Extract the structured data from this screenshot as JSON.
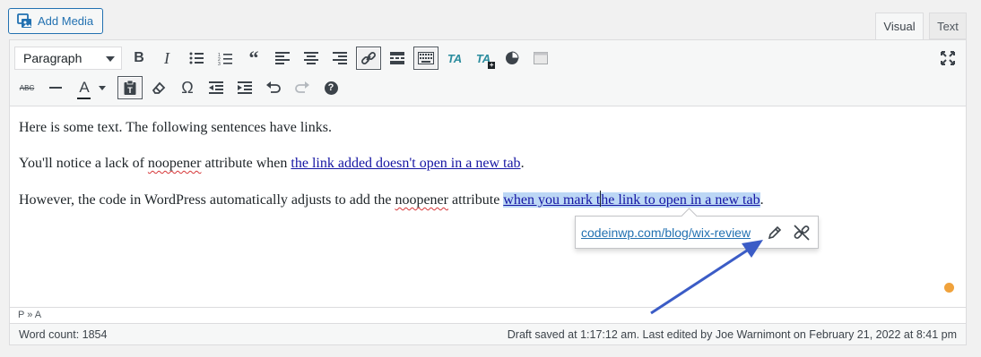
{
  "add_media": {
    "label": "Add Media"
  },
  "tabs": {
    "visual": "Visual",
    "text": "Text"
  },
  "toolbar": {
    "format_select": "Paragraph",
    "row1_icons": [
      "bold-icon",
      "italic-icon",
      "bulleted-list-icon",
      "numbered-list-icon",
      "blockquote-icon",
      "align-left-icon",
      "align-center-icon",
      "align-right-icon",
      "insert-link-icon",
      "read-more-icon",
      "toolbar-toggle-icon",
      "ta-icon",
      "ta-plus-icon",
      "pie-chart-icon",
      "shortcode-icon"
    ],
    "row2_icons": [
      "strikethrough-icon",
      "horizontal-line-icon",
      "text-color-icon",
      "paste-text-icon",
      "clear-formatting-icon",
      "special-character-icon",
      "outdent-icon",
      "indent-icon",
      "undo-icon",
      "redo-icon",
      "help-icon"
    ],
    "bold": "B",
    "italic": "I",
    "omega": "Ω",
    "strike": "ABC",
    "text_color": "A",
    "ta": "TA",
    "help": "?"
  },
  "content": {
    "p1": "Here is some text. The following sentences have links.",
    "p2_before": "You'll notice a lack of ",
    "p2_spell": "noopener",
    "p2_mid": " attribute when ",
    "p2_link": "the link added doesn't open in a new tab",
    "p2_after": ".",
    "p3_before": "However, the code in WordPress automatically adjusts to add the ",
    "p3_spell": "noopener",
    "p3_mid": " attribute ",
    "p3_link_a": "when you mark t",
    "p3_link_b": "he link to open in a new tab",
    "p3_after": "."
  },
  "link_popup": {
    "url": "codeinwp.com/blog/wix-review"
  },
  "colors": {
    "accent": "#2271b1",
    "arrow": "#3b5cc6",
    "selection": "#bcd7f5",
    "dot": "#f0a23c"
  },
  "path": "P » A",
  "status": {
    "word_count": "Word count: 1854",
    "draft": "Draft saved at 1:17:12 am. Last edited by Joe Warnimont on February 21, 2022 at 8:41 pm"
  }
}
